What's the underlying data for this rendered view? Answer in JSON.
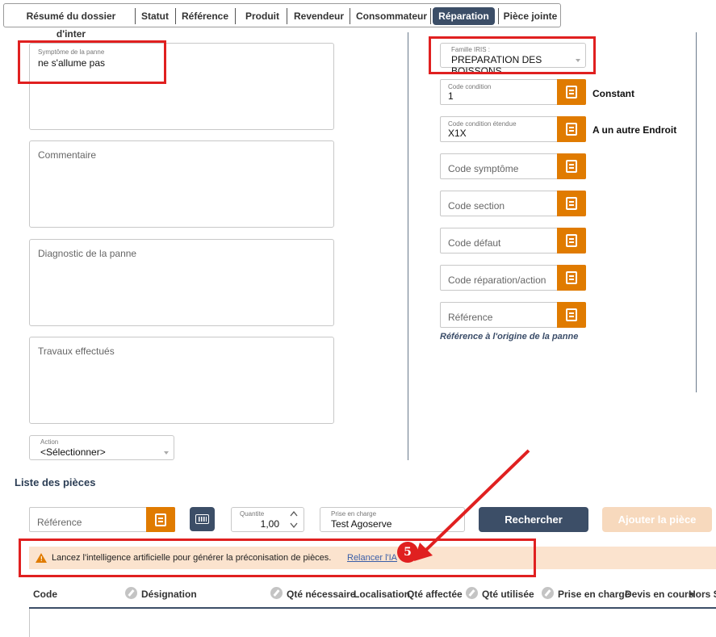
{
  "tabs": [
    {
      "label": "Résumé du dossier d'inter",
      "active": false
    },
    {
      "label": "Statut",
      "active": false
    },
    {
      "label": "Référence",
      "active": false
    },
    {
      "label": "Produit",
      "active": false
    },
    {
      "label": "Revendeur",
      "active": false
    },
    {
      "label": "Consommateur",
      "active": false
    },
    {
      "label": "Réparation",
      "active": true
    },
    {
      "label": "Pièce jointe",
      "active": false
    }
  ],
  "left": {
    "symptome": {
      "label": "Symptôme de la panne",
      "value": "ne s'allume pas"
    },
    "commentaire": {
      "placeholder": "Commentaire"
    },
    "diagnostic": {
      "placeholder": "Diagnostic de la panne"
    },
    "travaux": {
      "placeholder": "Travaux effectués"
    },
    "action": {
      "label": "Action",
      "value": "<Sélectionner>"
    }
  },
  "right": {
    "famille": {
      "label": "Famille IRIS :",
      "value": "PREPARATION DES BOISSONS"
    },
    "code_condition": {
      "label": "Code condition",
      "value": "1",
      "description": "Constant"
    },
    "code_condition_etendue": {
      "label": "Code condition étendue",
      "value": "X1X",
      "description": "A un autre Endroit"
    },
    "code_symptome": {
      "placeholder": "Code symptôme"
    },
    "code_section": {
      "placeholder": "Code section"
    },
    "code_defaut": {
      "placeholder": "Code défaut"
    },
    "code_reparation": {
      "placeholder": "Code réparation/action"
    },
    "reference": {
      "placeholder": "Référence"
    },
    "reference_note": "Référence à l'origine de la panne"
  },
  "pieces": {
    "title": "Liste des pièces",
    "reference_placeholder": "Référence",
    "quantite": {
      "label": "Quantite",
      "value": "1,00"
    },
    "prise_en_charge": {
      "label": "Prise en charge",
      "value": "Test Agoserve"
    },
    "search_button": "Rechercher",
    "add_button": "Ajouter la pièce",
    "ai_banner": {
      "message": "Lancez l'intelligence artificielle pour générer la préconisation de pièces.",
      "link": "Relancer l'IA"
    },
    "annotation_number": "5",
    "columns": [
      "Code",
      "Désignation",
      "Qté nécessaire",
      "Localisation",
      "Qté affectée",
      "Qté utilisée",
      "Prise en charge",
      "Devis en cours",
      "Hors St"
    ]
  },
  "colors": {
    "accent_navy": "#3c4e67",
    "accent_orange": "#e07b00",
    "highlight_red": "#e02020",
    "banner_bg": "#fbe3ce"
  },
  "icons": [
    "warning-icon",
    "document-icon",
    "barcode-icon",
    "pencil-icon",
    "chevron-up-icon",
    "chevron-down-icon",
    "dropdown-caret-icon",
    "arrow-annotation"
  ]
}
